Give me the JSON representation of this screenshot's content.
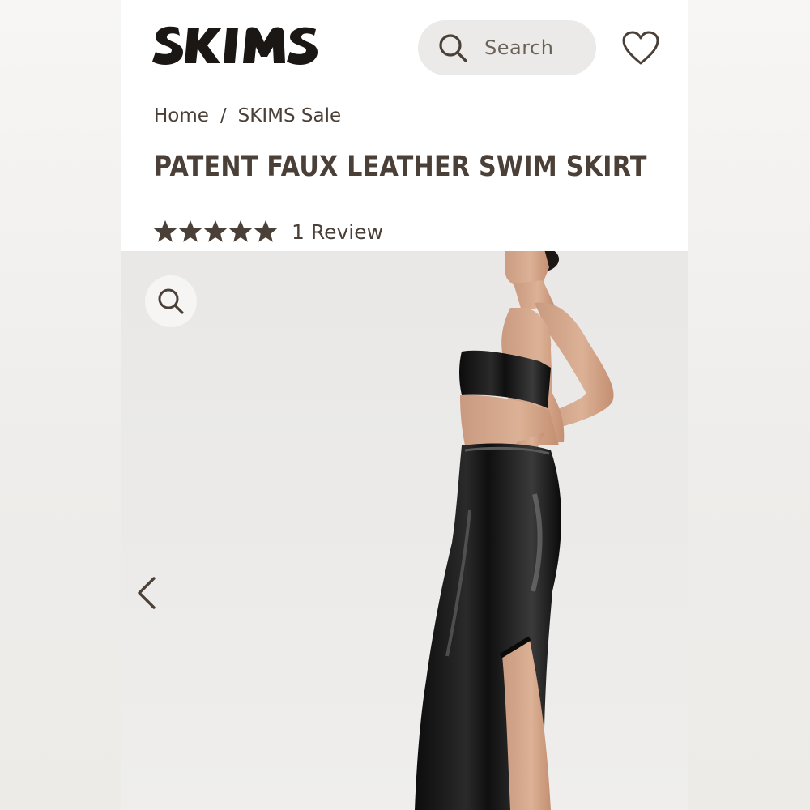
{
  "brand": {
    "logo_text": "SKIMS"
  },
  "search": {
    "label": "Search"
  },
  "breadcrumb": {
    "home": "Home",
    "separator": "/",
    "current": "SKIMS Sale"
  },
  "product": {
    "title": "PATENT FAUX LEATHER SWIM SKIRT",
    "rating": 5,
    "rating_max": 5,
    "reviews_label": "1 Review"
  },
  "icons": {
    "search": "search-icon",
    "wishlist": "heart-icon",
    "zoom": "zoom-icon",
    "previous": "chevron-left-icon",
    "star": "star-icon"
  },
  "colors": {
    "text": "#4b4037",
    "brand": "#1b1714",
    "search_bg": "#ebeae8",
    "image_bg": "#eae9e7"
  }
}
